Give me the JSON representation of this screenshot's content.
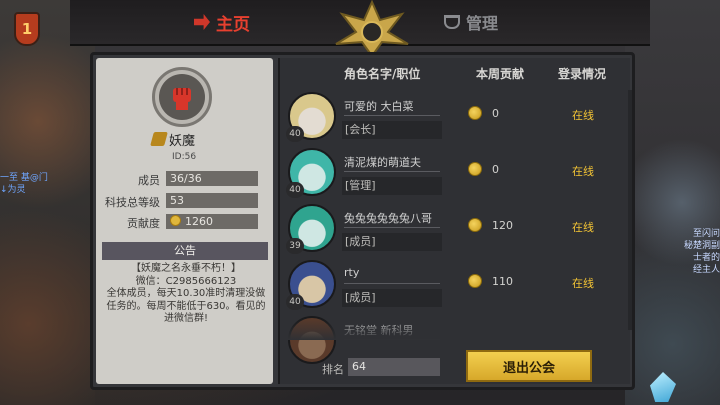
{
  "tabs": {
    "home": "主页",
    "manage": "管理"
  },
  "colors": {
    "accent_red": "#e8402f",
    "gold_button": "#f3cf4f",
    "online": "#f2c335"
  },
  "background": {
    "level_badge": "1",
    "left_chat": [
      "一至 基@门",
      "↓为灵"
    ],
    "right_chat": [
      "至闪问",
      "秘楚洞副",
      "士者的",
      "经主人"
    ]
  },
  "guild": {
    "name": "妖魔",
    "id": "ID:56",
    "stats": [
      {
        "label": "成员",
        "value": "36/36"
      },
      {
        "label": "科技总等级",
        "value": "53"
      },
      {
        "label": "贡献度",
        "value": "1260"
      }
    ],
    "notice_title": "公告",
    "notice_text": "【妖魔之名永垂不朽！】\n微信：C2985666123\n全体成员，每天10.30准时清理没做任务的。每周不能低于630。看见的进微信群!"
  },
  "list": {
    "headers": {
      "name": "角色名字/职位",
      "contribution": "本周贡献",
      "status": "登录情况"
    },
    "rows": [
      {
        "name": "可爱的 大白菜",
        "role": "[会长]",
        "level": "40",
        "contribution": "0",
        "status": "在线",
        "avatar_color": "#e3dcd2",
        "hair": "#d9c88c"
      },
      {
        "name": "清泥煤的萌道夫",
        "role": "[管理]",
        "level": "40",
        "contribution": "0",
        "status": "在线",
        "avatar_color": "#cfe7e3",
        "hair": "#3fb6a8"
      },
      {
        "name": "兔兔兔兔兔兔八哥",
        "role": "[成员]",
        "level": "39",
        "contribution": "120",
        "status": "在线",
        "avatar_color": "#cfe7e3",
        "hair": "#2fa48f"
      },
      {
        "name": "rty",
        "role": "[成员]",
        "level": "40",
        "contribution": "110",
        "status": "在线",
        "avatar_color": "#d8c6a6",
        "hair": "#3a4f8f"
      },
      {
        "name": "无铭堂 新科男",
        "role": "",
        "level": "",
        "contribution": "",
        "status": "",
        "avatar_color": "#8a6a52",
        "hair": "#5a3a2a"
      }
    ]
  },
  "footer": {
    "rank_label": "排名",
    "rank_value": "64",
    "quit_button": "退出公会"
  }
}
